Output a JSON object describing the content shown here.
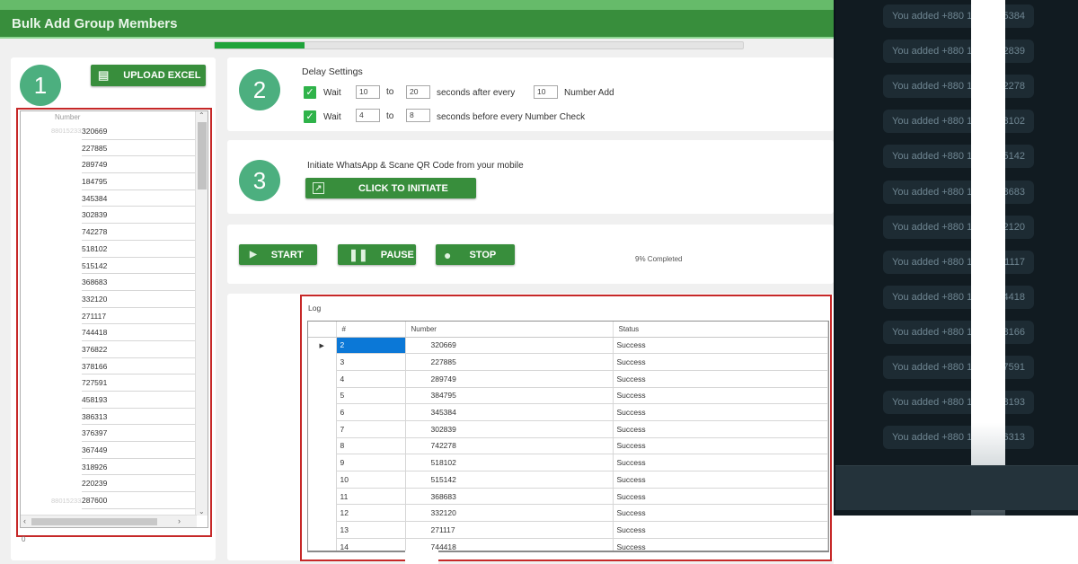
{
  "window": {
    "title": "Bulk Add Group Members",
    "progress_fraction": 0.17
  },
  "step1": {
    "number": "1",
    "upload_button": "UPLOAD EXCEL",
    "upload_icon": "excel-icon",
    "list_header": "Number",
    "numbers": [
      "320669",
      "227885",
      "289749",
      "184795",
      "345384",
      "302839",
      "742278",
      "518102",
      "515142",
      "368683",
      "332120",
      "271117",
      "744418",
      "376822",
      "378166",
      "727591",
      "458193",
      "386313",
      "376397",
      "367449",
      "318926",
      "220239",
      "287600"
    ],
    "partial_prefix": "88015233",
    "count_label": "0"
  },
  "step2": {
    "number": "2",
    "title": "Delay Settings",
    "row1": {
      "checked": true,
      "wait_label": "Wait",
      "from": "10",
      "to_label": "to",
      "to": "20",
      "suffix": "seconds after every",
      "every": "10",
      "end_label": "Number Add"
    },
    "row2": {
      "checked": true,
      "wait_label": "Wait",
      "from": "4",
      "to_label": "to",
      "to": "8",
      "suffix": "seconds before every Number Check"
    }
  },
  "step3": {
    "number": "3",
    "instruction": "Initiate WhatsApp & Scane QR Code from your mobile",
    "initiate_button": "CLICK TO INITIATE"
  },
  "controls": {
    "start": "START",
    "pause": "PAUSE",
    "stop": "STOP",
    "status": "9% Completed"
  },
  "log": {
    "title": "Log",
    "columns": [
      "#",
      "Number",
      "Status"
    ],
    "rows": [
      {
        "id": "2",
        "number": "320669",
        "status": "Success"
      },
      {
        "id": "3",
        "number": "227885",
        "status": "Success"
      },
      {
        "id": "4",
        "number": "289749",
        "status": "Success"
      },
      {
        "id": "5",
        "number": "384795",
        "status": "Success"
      },
      {
        "id": "6",
        "number": "345384",
        "status": "Success"
      },
      {
        "id": "7",
        "number": "302839",
        "status": "Success"
      },
      {
        "id": "8",
        "number": "742278",
        "status": "Success"
      },
      {
        "id": "9",
        "number": "518102",
        "status": "Success"
      },
      {
        "id": "10",
        "number": "515142",
        "status": "Success"
      },
      {
        "id": "11",
        "number": "368683",
        "status": "Success"
      },
      {
        "id": "12",
        "number": "332120",
        "status": "Success"
      },
      {
        "id": "13",
        "number": "271117",
        "status": "Success"
      },
      {
        "id": "14",
        "number": "744418",
        "status": "Success"
      }
    ]
  },
  "whatsapp": {
    "messages": [
      {
        "prefix": "You added +880 1",
        "suffix": "5384"
      },
      {
        "prefix": "You added +880 1",
        "suffix": "2839"
      },
      {
        "prefix": "You added +880 1",
        "suffix": "2278"
      },
      {
        "prefix": "You added +880 1",
        "suffix": "8102"
      },
      {
        "prefix": "You added +880 1",
        "suffix": "5142"
      },
      {
        "prefix": "You added +880 1",
        "suffix": "8683"
      },
      {
        "prefix": "You added +880 1",
        "suffix": "2120"
      },
      {
        "prefix": "You added +880 1",
        "suffix": "1117"
      },
      {
        "prefix": "You added +880 1",
        "suffix": "4418"
      },
      {
        "prefix": "You added +880 1",
        "suffix": "8166"
      },
      {
        "prefix": "You added +880 1",
        "suffix": "7591"
      },
      {
        "prefix": "You added +880 1",
        "suffix": "8193"
      },
      {
        "prefix": "You added +880 1",
        "suffix": "6313"
      }
    ]
  },
  "colors": {
    "header_green": "#388e3c",
    "button_green": "#388e3c",
    "step_circle": "#4caf7f",
    "highlight_red": "#c62828",
    "selection_blue": "#0b78d7",
    "chat_bg": "#111b21"
  }
}
